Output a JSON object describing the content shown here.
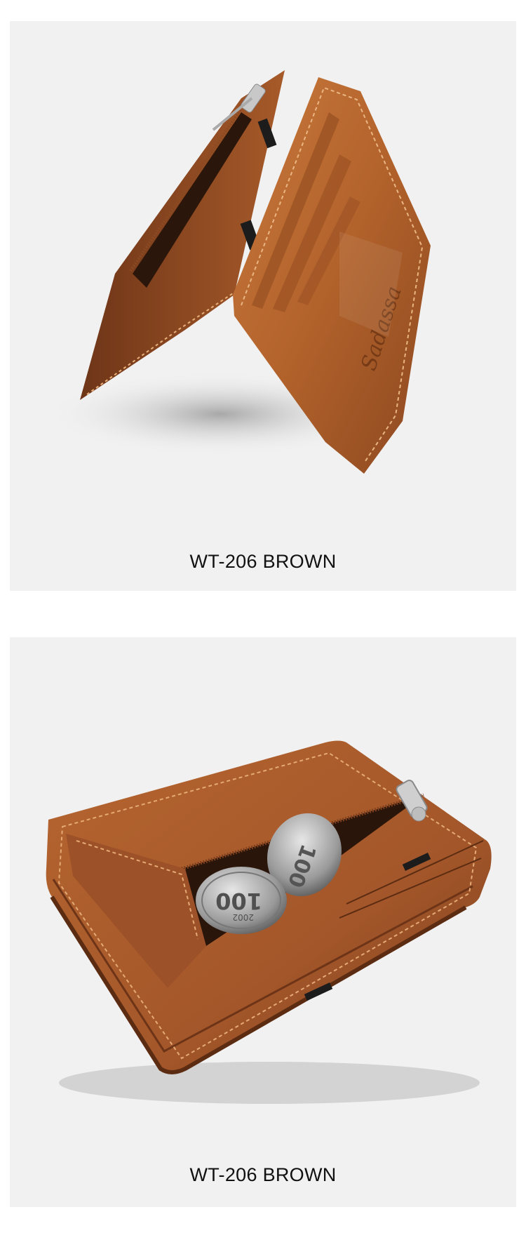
{
  "products": [
    {
      "caption": "WT-206 BROWN",
      "brand_emboss": "Sadassa",
      "colors": {
        "leather": "#b9692f",
        "leather_dark": "#7a3d18",
        "background": "#f1f1f1"
      }
    },
    {
      "caption": "WT-206 BROWN",
      "coin_text": "100",
      "coin_year": "2002",
      "colors": {
        "leather": "#a85a2c",
        "leather_dark": "#6e3417",
        "background": "#f1f1f1"
      }
    }
  ]
}
